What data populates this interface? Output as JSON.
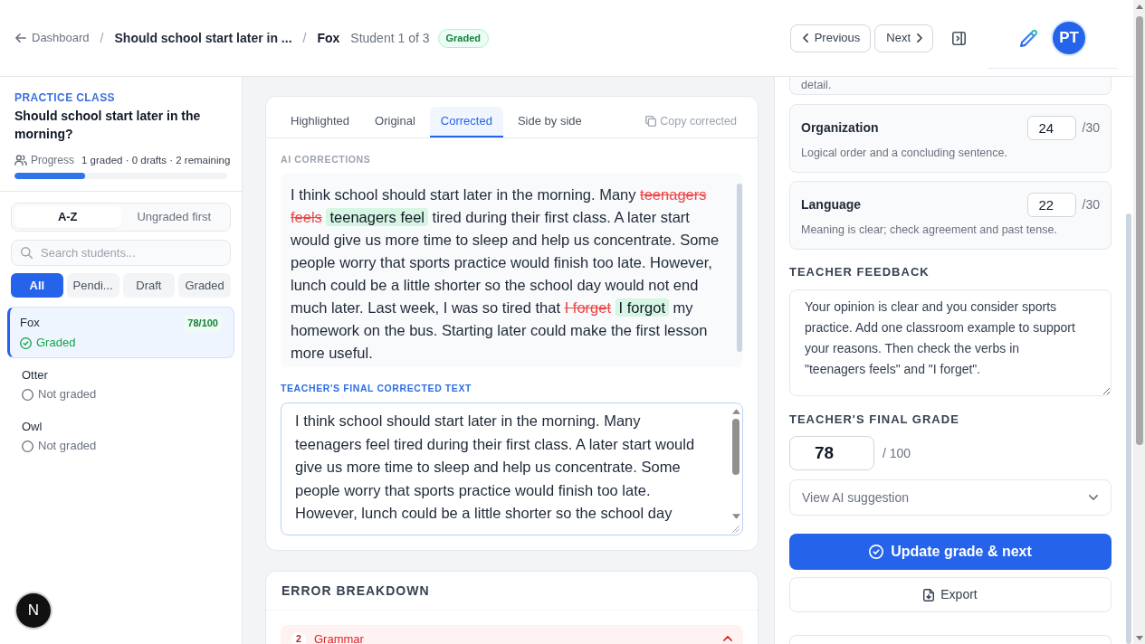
{
  "header": {
    "breadcrumb": [
      {
        "kind": "back",
        "text": "Dashboard"
      },
      {
        "kind": "separator",
        "text": "/"
      },
      {
        "kind": "title",
        "text": "Should school start later in ..."
      },
      {
        "kind": "separator",
        "text": "/"
      },
      {
        "kind": "student",
        "text": "Fox"
      },
      {
        "kind": "meta",
        "text": "Student 1 of 3"
      },
      {
        "kind": "badge",
        "text": "Graded"
      }
    ],
    "nav_buttons": [
      {
        "kind": "previous",
        "label": "Previous"
      },
      {
        "kind": "next",
        "label": "Next"
      }
    ],
    "avatar": "PT"
  },
  "sidebar": {
    "class_label": "PRACTICE CLASS",
    "title": "Should school start later in the morning?",
    "progress": {
      "label": "Progress",
      "summary": "1 graded · 0 drafts · 2 remaining",
      "level": 0.33
    },
    "sort_options": [
      {
        "label": "A-Z",
        "selected": true
      },
      {
        "label": "Ungraded first",
        "selected": false
      }
    ],
    "search": {
      "placeholder": "Search students..."
    },
    "filters": [
      {
        "label": "All",
        "selected": true
      },
      {
        "label": "Pendi...",
        "selected": false
      },
      {
        "label": "Draft",
        "selected": false
      },
      {
        "label": "Graded",
        "selected": false
      }
    ],
    "students": [
      {
        "name": "Fox",
        "score": "78/100",
        "status": "Graded",
        "graded": true,
        "selected": true
      },
      {
        "name": "Otter",
        "status": "Not graded",
        "graded": false,
        "selected": false
      },
      {
        "name": "Owl",
        "status": "Not graded",
        "graded": false,
        "selected": false
      }
    ]
  },
  "dev_indicator": "N",
  "essay": {
    "tabs": [
      {
        "label": "Highlighted",
        "selected": false
      },
      {
        "label": "Original",
        "selected": false
      },
      {
        "label": "Corrected",
        "selected": true
      },
      {
        "label": "Side by side",
        "selected": false
      }
    ],
    "copy_action": "Copy corrected",
    "ai_corrections": {
      "label": "AI CORRECTIONS",
      "segments": [
        {
          "kind": "text",
          "text": "I think school should start later in the morning. Many "
        },
        {
          "kind": "deleted",
          "text": "teenagers feels"
        },
        {
          "kind": "inserted",
          "text": "teenagers feel"
        },
        {
          "kind": "text",
          "text": " tired during their first class. A later start would give us more time to sleep and help us concentrate. Some people worry that sports practice would finish too late. However, lunch could be a little shorter so the school day would not end much later. Last week, I was so tired that "
        },
        {
          "kind": "deleted",
          "text": "I forget"
        },
        {
          "kind": "inserted",
          "text": "I forgot"
        },
        {
          "kind": "text",
          "text": " my homework on the bus. Starting later could make the first lesson more useful."
        }
      ]
    },
    "final_text": {
      "label": "TEACHER'S FINAL CORRECTED TEXT",
      "value": "I think school should start later in the morning. Many teenagers feel tired during their first class. A later start would give us more time to sleep and help us concentrate. Some people worry that sports practice would finish too late. However, lunch could be a little shorter so the school day"
    }
  },
  "error_breakdown": {
    "title": "ERROR BREAKDOWN",
    "categories": [
      {
        "count": "2",
        "name": "Grammar",
        "expanded": true
      }
    ]
  },
  "grading": {
    "criteria": [
      {
        "kind": "partial",
        "description": "detail."
      },
      {
        "kind": "full",
        "name": "Organization",
        "score": "24",
        "max": "/30",
        "description": "Logical order and a concluding sentence."
      },
      {
        "kind": "full",
        "name": "Language",
        "score": "22",
        "max": "/30",
        "description": "Meaning is clear; check agreement and past tense."
      }
    ],
    "feedback": {
      "label": "TEACHER FEEDBACK",
      "value": "Your opinion is clear and you consider sports practice. Add one classroom example to support your reasons. Then check the verbs in \"teenagers feels\" and \"I forget\"."
    },
    "final_grade": {
      "label": "TEACHER'S FINAL GRADE",
      "value": "78",
      "max": "/ 100"
    },
    "ai_suggestion": {
      "label": "View AI suggestion",
      "expanded": false
    },
    "actions": [
      {
        "kind": "primary",
        "label": "Update grade & next"
      },
      {
        "kind": "export",
        "label": "Export"
      }
    ]
  }
}
